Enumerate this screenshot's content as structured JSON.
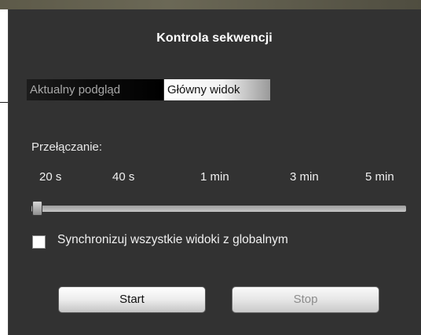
{
  "dialog": {
    "title": "Kontrola sekwencji"
  },
  "tabs": [
    {
      "label": "Aktualny podgląd",
      "active": false
    },
    {
      "label": "Główny widok",
      "active": true
    }
  ],
  "switching": {
    "label": "Przełączanie:",
    "ticks": [
      "20 s",
      "40 s",
      "1 min",
      "3 min",
      "5 min"
    ],
    "selected": "20 s"
  },
  "sync": {
    "label": "Synchronizuj wszystkie widoki z globalnym",
    "checked": false
  },
  "buttons": {
    "start": "Start",
    "stop": "Stop",
    "stop_enabled": false
  },
  "colors": {
    "panel_bg": "#323232",
    "text": "#f0f0f0",
    "disabled_text": "#8c8c8c"
  }
}
